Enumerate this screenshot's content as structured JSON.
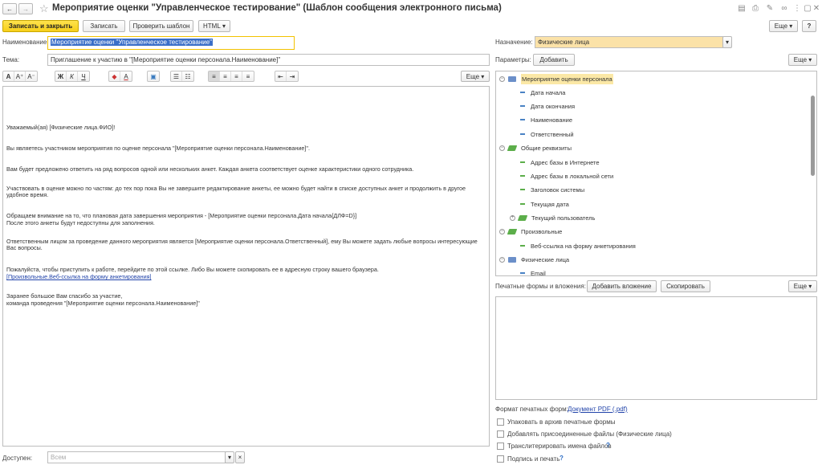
{
  "window": {
    "title": "Мероприятие оценки \"Управленческое тестирование\" (Шаблон сообщения электронного письма)",
    "back_glyph": "←",
    "forward_glyph": "→",
    "star_glyph": "☆"
  },
  "toolbar": {
    "save_close": "Записать и закрыть",
    "save": "Записать",
    "check": "Проверить шаблон",
    "html": "HTML",
    "more": "Еще",
    "help": "?"
  },
  "form": {
    "name_label": "Наименование:",
    "name_value": "Мероприятие оценки \"Управленческое тестирование\"",
    "subject_label": "Тема:",
    "subject_value": "Приглашение к участию в \"[Мероприятие оценки персонала.Наименование]\"",
    "available_label": "Доступен:",
    "available_placeholder": "Всем"
  },
  "format_toolbar": {
    "font": [
      "A",
      "A⁺",
      "A⁻"
    ],
    "style": [
      "Ж",
      "К",
      "Ч"
    ],
    "color": [
      "◆",
      "A"
    ],
    "picture": [
      "▣"
    ],
    "lists": [
      "☰",
      "☷"
    ],
    "align": [
      "≡",
      "≡",
      "≡",
      "≡"
    ],
    "indent": [
      "⇤",
      "⇥"
    ],
    "more": "Еще"
  },
  "message": {
    "p1": "Уважаемый(ая) [Физические лица.ФИО]!",
    "p2": "Вы являетесь участником мероприятия по оценке персонала \"[Мероприятие оценки персонала.Наименование]\".",
    "p3": "Вам будет предложено ответить на ряд вопросов одной или нескольких анкет. Каждая анкета соответствует оценке характеристики одного сотрудника.",
    "p4": "Участвовать в оценке можно по частям: до тех пор пока Вы не завершите редактирование анкеты, ее можно будет найти в списке доступных анкет и продолжить в другое удобное время.",
    "p5_line1": "Обращаем внимание на то, что плановая дата завершения мероприятия - [Мероприятие оценки персонала.Дата начала{ДЛФ=D}]",
    "p5_line2": "После этого анкеты будут недоступны для заполнения.",
    "p6": "Ответственным лицом за проведение данного мероприятия является [Мероприятие оценки персонала.Ответственный], ему Вы можете задать любые вопросы интересующие Вас вопросы.",
    "p7": "Пожалуйста, чтобы приступить к работе, перейдите по этой ссылке. Либо Вы можете скопировать ее в адресную строку вашего браузера.",
    "p7_link": "[Произвольные.Веб-ссылка на форму анкетирования]",
    "p8_line1": "Заранее большое Вам спасибо за участие,",
    "p8_line2": "команда проведения \"[Мероприятие оценки персонала.Наименование]\""
  },
  "right": {
    "purpose_label": "Назначение:",
    "purpose_value": "Физические лица",
    "params_label": "Параметры:",
    "add_button": "Добавить",
    "more": "Еще",
    "tree": [
      {
        "label": "Мероприятие оценки персонала",
        "kind": "group",
        "expanded": true,
        "selected": true
      },
      {
        "label": "Дата начала",
        "kind": "leaf"
      },
      {
        "label": "Дата окончания",
        "kind": "leaf"
      },
      {
        "label": "Наименование",
        "kind": "leaf"
      },
      {
        "label": "Ответственный",
        "kind": "leaf"
      },
      {
        "label": "Общие реквизиты",
        "kind": "group",
        "expanded": true
      },
      {
        "label": "Адрес базы в Интернете",
        "kind": "leaf"
      },
      {
        "label": "Адрес базы в локальной сети",
        "kind": "leaf"
      },
      {
        "label": "Заголовок системы",
        "kind": "leaf"
      },
      {
        "label": "Текущая дата",
        "kind": "leaf"
      },
      {
        "label": "Текущий пользователь",
        "kind": "group",
        "expanded": false
      },
      {
        "label": "Произвольные",
        "kind": "group",
        "expanded": true
      },
      {
        "label": "Веб-ссылка на форму анкетирования",
        "kind": "leaf"
      },
      {
        "label": "Физические лица",
        "kind": "group",
        "expanded": true
      },
      {
        "label": "Email",
        "kind": "leaf"
      }
    ],
    "print_label": "Печатные формы и вложения:",
    "add_attachment": "Добавить вложение",
    "copy": "Скопировать",
    "print_more": "Еще",
    "format_label": "Формат печатных форм:",
    "format_link": "Документ PDF (.pdf)",
    "checkboxes": [
      {
        "label": "Упаковать в архив печатные формы",
        "help": ""
      },
      {
        "label": "Добавлять присоединенные файлы (Физические лица)",
        "help": ""
      },
      {
        "label": "Транслитерировать имена файлов",
        "help": "?"
      },
      {
        "label": "Подпись и печать",
        "help": "?"
      }
    ]
  },
  "colors": {
    "primary": "#f7cf1b",
    "selected_row": "#fbe8a6",
    "purpose_field": "#fbe2a8",
    "link": "#2244aa"
  }
}
